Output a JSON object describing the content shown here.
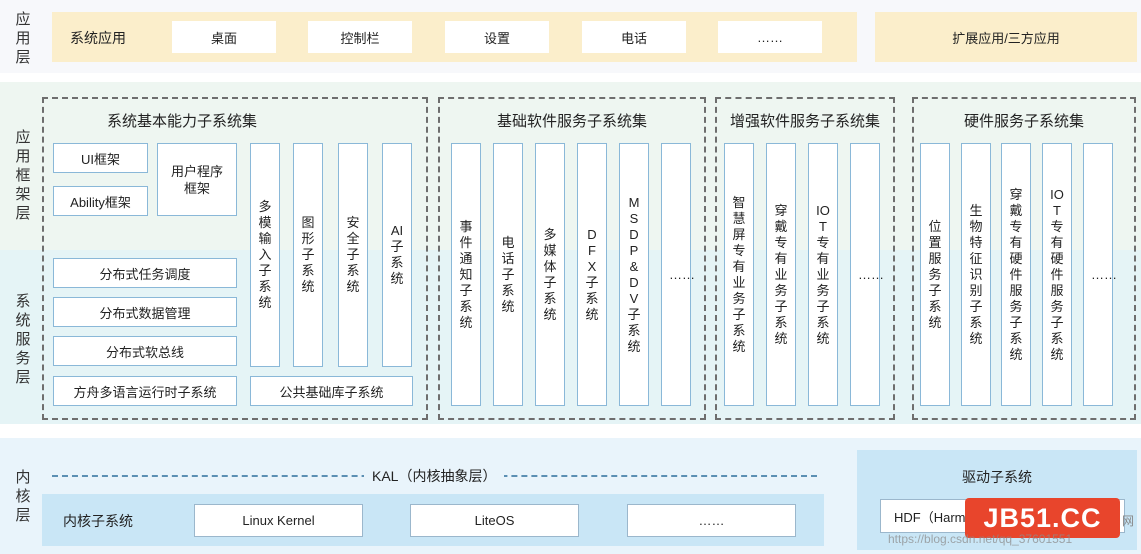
{
  "colors": {
    "app_band": "#fbeecb",
    "framework_band": "#eef6f1",
    "service_band": "#e5f4f6",
    "kernel_band": "#e9f4fb",
    "kernel_inner": "#c9e6f6",
    "box_border": "#8ab8d8",
    "dash": "#6e6e6e",
    "watermark_bg": "#e8452c"
  },
  "layers": {
    "app": "应用层",
    "framework": "应用框架层",
    "service": "系统服务层",
    "kernel": "内核层"
  },
  "app_layer": {
    "system_apps_label": "系统应用",
    "apps": [
      "桌面",
      "控制栏",
      "设置",
      "电话",
      "……"
    ],
    "extension_apps": "扩展应用/三方应用"
  },
  "group_basic": {
    "title": "系统基本能力子系统集",
    "ui_framework": "UI框架",
    "ability_framework": "Ability框架",
    "user_program_framework": "用户程序框架",
    "vertical": [
      "多模输入子系统",
      "图形子系统",
      "安全子系统",
      "AI子系统"
    ],
    "distributed": [
      "分布式任务调度",
      "分布式数据管理",
      "分布式软总线"
    ],
    "ark_runtime": "方舟多语言运行时子系统",
    "common_lib": "公共基础库子系统"
  },
  "group_software": {
    "title": "基础软件服务子系统集",
    "vertical": [
      "事件通知子系统",
      "电话子系统",
      "多媒体子系统",
      "DFX子系统",
      "MSDP&DV子系统",
      "……"
    ]
  },
  "group_enhanced": {
    "title": "增强软件服务子系统集",
    "vertical": [
      "智慧屏专有业务子系统",
      "穿戴专有业务子系统",
      "IOT专有业务子系统",
      "……"
    ]
  },
  "group_hardware": {
    "title": "硬件服务子系统集",
    "vertical": [
      "位置服务子系统",
      "生物特征识别子系统",
      "穿戴专有硬件服务子系统",
      "IOT专有硬件服务子系统",
      "……"
    ]
  },
  "kernel_layer": {
    "kal": "KAL（内核抽象层）",
    "kernel_subsystem": "内核子系统",
    "kernels": [
      "Linux Kernel",
      "LiteOS",
      "……"
    ],
    "driver_subsystem": "驱动子系统",
    "hdf": "HDF（Harm"
  },
  "watermark": {
    "logo": "JB51.CC",
    "url_text": "https://blog.csdn.net/qq_37601551",
    "side_text": "网"
  }
}
